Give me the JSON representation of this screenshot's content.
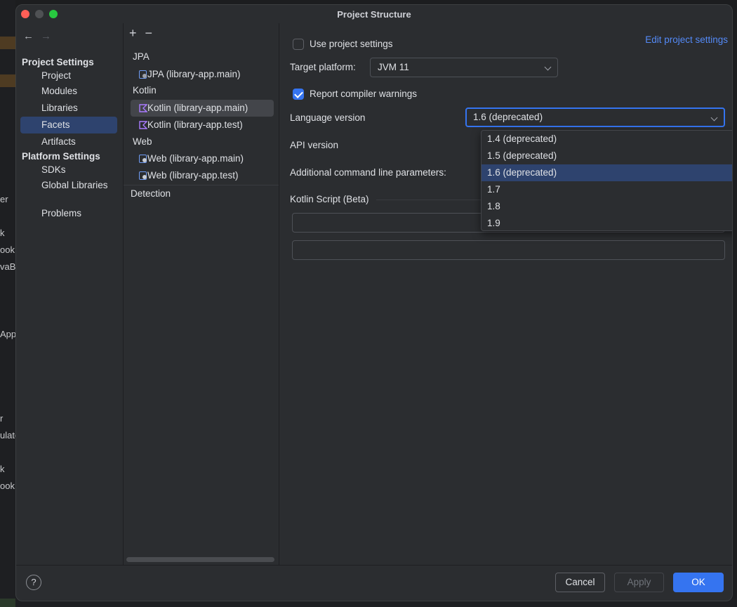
{
  "window": {
    "title": "Project Structure"
  },
  "background": {
    "fragments": [
      "er",
      "k",
      "ook",
      "vaB",
      "App",
      "r",
      "ulate",
      "k",
      "ook"
    ]
  },
  "left_nav": {
    "project_settings_header": "Project Settings",
    "project_items": [
      "Project",
      "Modules",
      "Libraries",
      "Facets",
      "Artifacts"
    ],
    "platform_settings_header": "Platform Settings",
    "platform_items": [
      "SDKs",
      "Global Libraries"
    ],
    "problems": "Problems",
    "selected": "Facets"
  },
  "facet_tree": {
    "add": "+",
    "remove": "−",
    "groups": [
      {
        "name": "JPA",
        "items": [
          "JPA (library-app.main)"
        ]
      },
      {
        "name": "Kotlin",
        "items": [
          "Kotlin (library-app.main)",
          "Kotlin (library-app.test)"
        ]
      },
      {
        "name": "Web",
        "items": [
          "Web (library-app.main)",
          "Web (library-app.test)"
        ]
      }
    ],
    "detection": "Detection",
    "selected": "Kotlin (library-app.main)"
  },
  "content": {
    "use_project_settings": {
      "label": "Use project settings",
      "checked": false
    },
    "edit_project_settings_link": "Edit project settings",
    "target_platform": {
      "label": "Target platform:",
      "value": "JVM 11"
    },
    "report_warnings": {
      "label": "Report compiler warnings",
      "checked": true
    },
    "language_version": {
      "label": "Language version",
      "value": "1.6 (deprecated)"
    },
    "api_version": {
      "label": "API version"
    },
    "additional_params": {
      "label": "Additional command line parameters:"
    },
    "kotlin_script": {
      "label": "Kotlin Script (Beta)"
    }
  },
  "dropdown": {
    "options": [
      "1.4 (deprecated)",
      "1.5 (deprecated)",
      "1.6 (deprecated)",
      "1.7",
      "1.8",
      "1.9"
    ],
    "selected": "1.6 (deprecated)"
  },
  "footer": {
    "help": "?",
    "cancel": "Cancel",
    "apply": "Apply",
    "ok": "OK"
  },
  "colors": {
    "accent": "#3574f0",
    "selection": "#2e436e",
    "link": "#548af7",
    "kotlin_icon": "#a97bff",
    "web_icon": "#4a8ff7"
  }
}
